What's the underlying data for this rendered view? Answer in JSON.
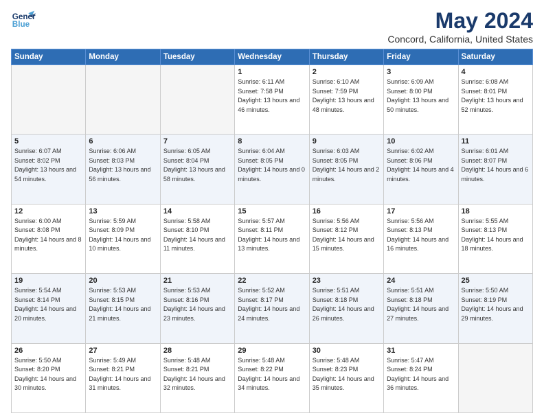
{
  "header": {
    "logo_general": "General",
    "logo_blue": "Blue",
    "main_title": "May 2024",
    "subtitle": "Concord, California, United States"
  },
  "days_of_week": [
    "Sunday",
    "Monday",
    "Tuesday",
    "Wednesday",
    "Thursday",
    "Friday",
    "Saturday"
  ],
  "weeks": [
    [
      {
        "day": "",
        "empty": true
      },
      {
        "day": "",
        "empty": true
      },
      {
        "day": "",
        "empty": true
      },
      {
        "day": "1",
        "sunrise": "Sunrise: 6:11 AM",
        "sunset": "Sunset: 7:58 PM",
        "daylight": "Daylight: 13 hours and 46 minutes."
      },
      {
        "day": "2",
        "sunrise": "Sunrise: 6:10 AM",
        "sunset": "Sunset: 7:59 PM",
        "daylight": "Daylight: 13 hours and 48 minutes."
      },
      {
        "day": "3",
        "sunrise": "Sunrise: 6:09 AM",
        "sunset": "Sunset: 8:00 PM",
        "daylight": "Daylight: 13 hours and 50 minutes."
      },
      {
        "day": "4",
        "sunrise": "Sunrise: 6:08 AM",
        "sunset": "Sunset: 8:01 PM",
        "daylight": "Daylight: 13 hours and 52 minutes."
      }
    ],
    [
      {
        "day": "5",
        "sunrise": "Sunrise: 6:07 AM",
        "sunset": "Sunset: 8:02 PM",
        "daylight": "Daylight: 13 hours and 54 minutes."
      },
      {
        "day": "6",
        "sunrise": "Sunrise: 6:06 AM",
        "sunset": "Sunset: 8:03 PM",
        "daylight": "Daylight: 13 hours and 56 minutes."
      },
      {
        "day": "7",
        "sunrise": "Sunrise: 6:05 AM",
        "sunset": "Sunset: 8:04 PM",
        "daylight": "Daylight: 13 hours and 58 minutes."
      },
      {
        "day": "8",
        "sunrise": "Sunrise: 6:04 AM",
        "sunset": "Sunset: 8:05 PM",
        "daylight": "Daylight: 14 hours and 0 minutes."
      },
      {
        "day": "9",
        "sunrise": "Sunrise: 6:03 AM",
        "sunset": "Sunset: 8:05 PM",
        "daylight": "Daylight: 14 hours and 2 minutes."
      },
      {
        "day": "10",
        "sunrise": "Sunrise: 6:02 AM",
        "sunset": "Sunset: 8:06 PM",
        "daylight": "Daylight: 14 hours and 4 minutes."
      },
      {
        "day": "11",
        "sunrise": "Sunrise: 6:01 AM",
        "sunset": "Sunset: 8:07 PM",
        "daylight": "Daylight: 14 hours and 6 minutes."
      }
    ],
    [
      {
        "day": "12",
        "sunrise": "Sunrise: 6:00 AM",
        "sunset": "Sunset: 8:08 PM",
        "daylight": "Daylight: 14 hours and 8 minutes."
      },
      {
        "day": "13",
        "sunrise": "Sunrise: 5:59 AM",
        "sunset": "Sunset: 8:09 PM",
        "daylight": "Daylight: 14 hours and 10 minutes."
      },
      {
        "day": "14",
        "sunrise": "Sunrise: 5:58 AM",
        "sunset": "Sunset: 8:10 PM",
        "daylight": "Daylight: 14 hours and 11 minutes."
      },
      {
        "day": "15",
        "sunrise": "Sunrise: 5:57 AM",
        "sunset": "Sunset: 8:11 PM",
        "daylight": "Daylight: 14 hours and 13 minutes."
      },
      {
        "day": "16",
        "sunrise": "Sunrise: 5:56 AM",
        "sunset": "Sunset: 8:12 PM",
        "daylight": "Daylight: 14 hours and 15 minutes."
      },
      {
        "day": "17",
        "sunrise": "Sunrise: 5:56 AM",
        "sunset": "Sunset: 8:13 PM",
        "daylight": "Daylight: 14 hours and 16 minutes."
      },
      {
        "day": "18",
        "sunrise": "Sunrise: 5:55 AM",
        "sunset": "Sunset: 8:13 PM",
        "daylight": "Daylight: 14 hours and 18 minutes."
      }
    ],
    [
      {
        "day": "19",
        "sunrise": "Sunrise: 5:54 AM",
        "sunset": "Sunset: 8:14 PM",
        "daylight": "Daylight: 14 hours and 20 minutes."
      },
      {
        "day": "20",
        "sunrise": "Sunrise: 5:53 AM",
        "sunset": "Sunset: 8:15 PM",
        "daylight": "Daylight: 14 hours and 21 minutes."
      },
      {
        "day": "21",
        "sunrise": "Sunrise: 5:53 AM",
        "sunset": "Sunset: 8:16 PM",
        "daylight": "Daylight: 14 hours and 23 minutes."
      },
      {
        "day": "22",
        "sunrise": "Sunrise: 5:52 AM",
        "sunset": "Sunset: 8:17 PM",
        "daylight": "Daylight: 14 hours and 24 minutes."
      },
      {
        "day": "23",
        "sunrise": "Sunrise: 5:51 AM",
        "sunset": "Sunset: 8:18 PM",
        "daylight": "Daylight: 14 hours and 26 minutes."
      },
      {
        "day": "24",
        "sunrise": "Sunrise: 5:51 AM",
        "sunset": "Sunset: 8:18 PM",
        "daylight": "Daylight: 14 hours and 27 minutes."
      },
      {
        "day": "25",
        "sunrise": "Sunrise: 5:50 AM",
        "sunset": "Sunset: 8:19 PM",
        "daylight": "Daylight: 14 hours and 29 minutes."
      }
    ],
    [
      {
        "day": "26",
        "sunrise": "Sunrise: 5:50 AM",
        "sunset": "Sunset: 8:20 PM",
        "daylight": "Daylight: 14 hours and 30 minutes."
      },
      {
        "day": "27",
        "sunrise": "Sunrise: 5:49 AM",
        "sunset": "Sunset: 8:21 PM",
        "daylight": "Daylight: 14 hours and 31 minutes."
      },
      {
        "day": "28",
        "sunrise": "Sunrise: 5:48 AM",
        "sunset": "Sunset: 8:21 PM",
        "daylight": "Daylight: 14 hours and 32 minutes."
      },
      {
        "day": "29",
        "sunrise": "Sunrise: 5:48 AM",
        "sunset": "Sunset: 8:22 PM",
        "daylight": "Daylight: 14 hours and 34 minutes."
      },
      {
        "day": "30",
        "sunrise": "Sunrise: 5:48 AM",
        "sunset": "Sunset: 8:23 PM",
        "daylight": "Daylight: 14 hours and 35 minutes."
      },
      {
        "day": "31",
        "sunrise": "Sunrise: 5:47 AM",
        "sunset": "Sunset: 8:24 PM",
        "daylight": "Daylight: 14 hours and 36 minutes."
      },
      {
        "day": "",
        "empty": true
      }
    ]
  ]
}
